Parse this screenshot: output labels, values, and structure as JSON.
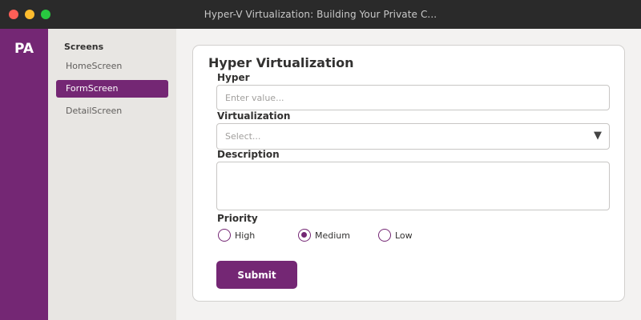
{
  "window": {
    "title": "Hyper-V Virtualization: Building Your Private C..."
  },
  "appbar": {
    "logo": "PA"
  },
  "screens": {
    "heading": "Screens",
    "items": [
      {
        "label": "HomeScreen",
        "active": false
      },
      {
        "label": "FormScreen",
        "active": true
      },
      {
        "label": "DetailScreen",
        "active": false
      }
    ]
  },
  "form": {
    "title": "Hyper Virtualization",
    "hyper": {
      "label": "Hyper",
      "placeholder": "Enter value...",
      "value": ""
    },
    "virtualization": {
      "label": "Virtualization",
      "selected": "Select..."
    },
    "description": {
      "label": "Description",
      "value": ""
    },
    "priority": {
      "label": "Priority",
      "options": [
        {
          "label": "High",
          "checked": false
        },
        {
          "label": "Medium",
          "checked": true
        },
        {
          "label": "Low",
          "checked": false
        }
      ]
    },
    "submit_label": "Submit"
  },
  "icons": {
    "dropdown": "triangle-down",
    "window_controls": [
      "close",
      "minimize",
      "maximize"
    ]
  },
  "colors": {
    "brand": "#742774",
    "titlebar": "#2a2a2a",
    "sidebar_bg": "#e8e6e3",
    "canvas_bg": "#f3f2f1",
    "close": "#ff5f57",
    "minimize": "#febc2e",
    "maximize": "#28c840"
  }
}
